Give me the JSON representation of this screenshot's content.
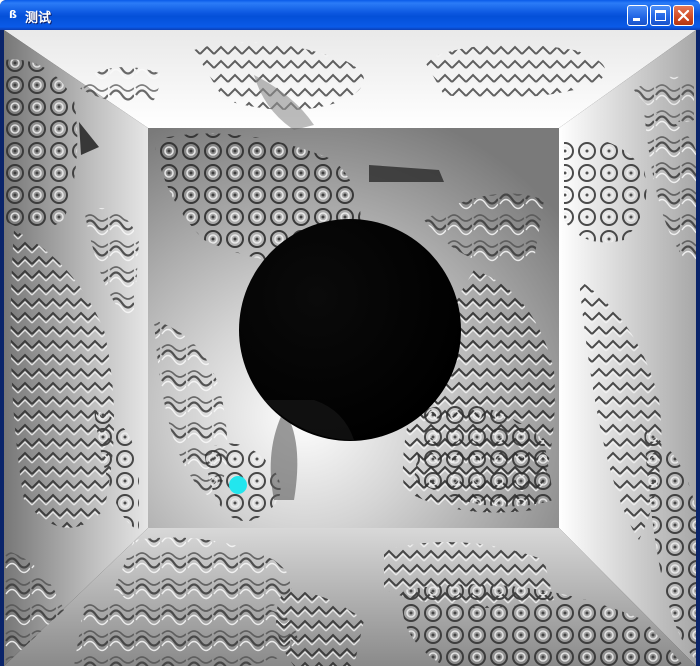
{
  "window": {
    "title": "测试",
    "icon": "opengl-app-icon",
    "controls": [
      "minimize-icon",
      "maximize-icon",
      "close-icon"
    ]
  },
  "scene": {
    "description_tags": [
      "textured-room",
      "black-sphere",
      "cyan-light-marker"
    ],
    "colors": {
      "sphere": "#000000",
      "light_marker": "#22e6ee",
      "wall_light": "#f2f2f2",
      "wall_dark": "#6a6a6a",
      "titlebar": "#0a5ae8",
      "close_button": "#d14a23"
    }
  }
}
